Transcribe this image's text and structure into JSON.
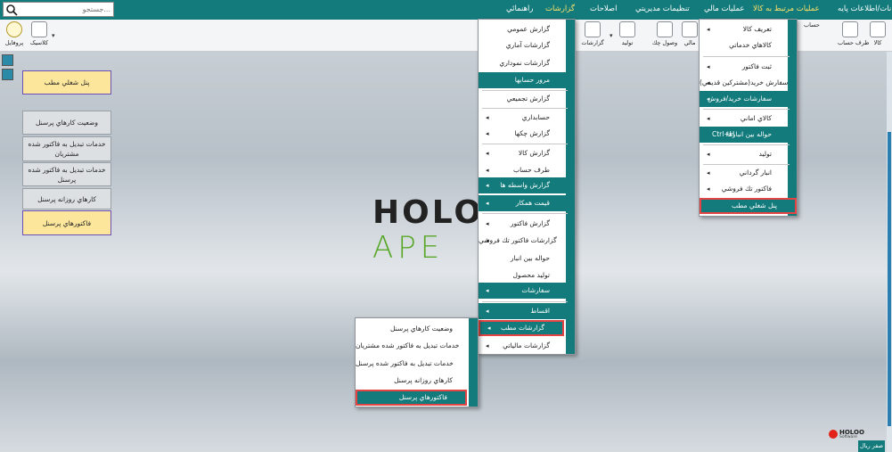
{
  "menubar": {
    "items": [
      "امکانات/اطلاعات پايه",
      "عمليات مرتبط به کالا",
      "عمليات مالي",
      "تنظيمات مديريتي",
      "اصلاحات",
      "گزارشات",
      "راهنمائي"
    ],
    "active": "عمليات مرتبط به کالا"
  },
  "search": {
    "placeholder": "جستجو..."
  },
  "toolbar": {
    "items": [
      "کالا",
      "طرف حساب",
      "حساب",
      "مالي",
      "وصول چك",
      "توليد",
      "گزارشات",
      "کلاسيک",
      "پروفايل"
    ]
  },
  "side_panels": [
    "پنل شغلي مطب",
    "وضعيت کارهاي پرسنل",
    "خدمات تبديل به فاکتور شده مشتريان",
    "خدمات تبديل به فاکتور شده پرسنل",
    "کارهاي روزانه پرسنل",
    "فاکتورهاي پرسنل"
  ],
  "logo": {
    "line1": "HOLO",
    "line2": "APE"
  },
  "menu_goods": {
    "rows": [
      "تعريف کالا",
      "کالاهاي خدماتي",
      "ثبت فاکتور",
      "سفارش خريد(مشترکين قديمي)",
      "سفارشات خريد/فروش",
      "کالاي اماني",
      "حواله بين انبارها",
      "توليد",
      "انبار گرداني",
      "فاکتور تك فروشي",
      "پنل شغلي مطب"
    ],
    "shortcut": "Ctrl+H"
  },
  "menu_reports": {
    "rows": [
      "گزارش عمومي",
      "گزارشات آماري",
      "گزارشات نموداري",
      "مرور حسابها",
      "گزارش تجميعي",
      "حسابداري",
      "گزارش چکها",
      "گزارش کالا",
      "طرف حساب",
      "گزارش واسطه ها",
      "قيمت همکار",
      "گزارش فاکتور",
      "گزارشات فاکتور تك فروشي",
      "حواله بين انبار",
      "توليد محصول",
      "سفارشات",
      "اقساط",
      "گزارشات مطب",
      "گزارشات مالياتي"
    ]
  },
  "menu_clinic": {
    "rows": [
      "وضعيت کارهاي پرسنل",
      "خدمات تبديل به فاکتور شده مشتريان",
      "خدمات تبديل به فاکتور شده پرسنل",
      "کارهاي روزانه پرسنل",
      "فاکتورهاي پرسنل"
    ]
  },
  "brand": {
    "name": "HOLOO",
    "sub": "Software",
    "fa": "هلو"
  },
  "status": {
    "label": "صفر ريال"
  },
  "colors": {
    "teal": "#137b7b",
    "highlight": "#e54444",
    "panel_yellow": "#fbe69c"
  }
}
